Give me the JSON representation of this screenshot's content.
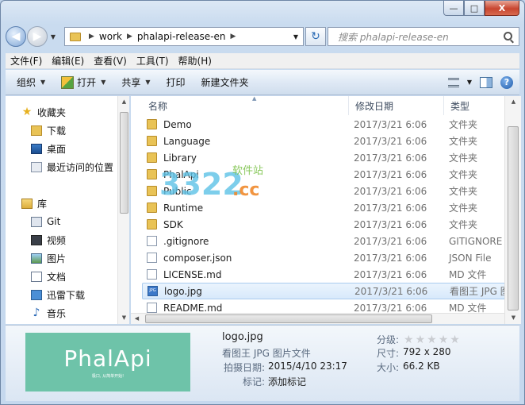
{
  "window": {
    "minimize_glyph": "—",
    "maximize_glyph": "□",
    "close_glyph": "X"
  },
  "address": {
    "crumbs": [
      "work",
      "phalapi-release-en"
    ],
    "search_placeholder": "搜索 phalapi-release-en"
  },
  "menu": [
    "文件(F)",
    "编辑(E)",
    "查看(V)",
    "工具(T)",
    "帮助(H)"
  ],
  "commands": {
    "organize": "组织",
    "open": "打开",
    "share": "共享",
    "print": "打印",
    "new_folder": "新建文件夹"
  },
  "navpane": {
    "favorites": "收藏夹",
    "items": [
      "下载",
      "桌面",
      "最近访问的位置"
    ],
    "libraries": "库",
    "lib_items": [
      "Git",
      "视频",
      "图片",
      "文档",
      "迅雷下载",
      "音乐"
    ]
  },
  "columns": {
    "name": "名称",
    "date": "修改日期",
    "type": "类型"
  },
  "files": [
    {
      "name": "Demo",
      "date": "2017/3/21 6:06",
      "type": "文件夹",
      "kind": "folder"
    },
    {
      "name": "Language",
      "date": "2017/3/21 6:06",
      "type": "文件夹",
      "kind": "folder"
    },
    {
      "name": "Library",
      "date": "2017/3/21 6:06",
      "type": "文件夹",
      "kind": "folder"
    },
    {
      "name": "PhalApi",
      "date": "2017/3/21 6:06",
      "type": "文件夹",
      "kind": "folder"
    },
    {
      "name": "Public",
      "date": "2017/3/21 6:06",
      "type": "文件夹",
      "kind": "folder"
    },
    {
      "name": "Runtime",
      "date": "2017/3/21 6:06",
      "type": "文件夹",
      "kind": "folder"
    },
    {
      "name": "SDK",
      "date": "2017/3/21 6:06",
      "type": "文件夹",
      "kind": "folder"
    },
    {
      "name": ".gitignore",
      "date": "2017/3/21 6:06",
      "type": "GITIGNORE 文件",
      "kind": "file"
    },
    {
      "name": "composer.json",
      "date": "2017/3/21 6:06",
      "type": "JSON File",
      "kind": "file"
    },
    {
      "name": "LICENSE.md",
      "date": "2017/3/21 6:06",
      "type": "MD 文件",
      "kind": "file"
    },
    {
      "name": "logo.jpg",
      "date": "2017/3/21 6:06",
      "type": "看图王 JPG 图片文件",
      "kind": "jpg",
      "selected": true
    },
    {
      "name": "README.md",
      "date": "2017/3/21 6:06",
      "type": "MD 文件",
      "kind": "file"
    }
  ],
  "watermark": {
    "digits": "3322",
    "site": "软件站",
    "tld": ".cc"
  },
  "details": {
    "filename": "logo.jpg",
    "filetype": "看图王 JPG 图片文件",
    "date_label": "拍摄日期:",
    "date_value": "2015/4/10 23:17",
    "tags_label": "标记:",
    "tags_value": "添加标记",
    "rating_label": "分级:",
    "dims_label": "尺寸:",
    "dims_value": "792 x 280",
    "size_label": "大小:",
    "size_value": "66.2 KB",
    "thumb_logo": "PhalApi",
    "thumb_tagline": "极口, 从简单开始!"
  }
}
